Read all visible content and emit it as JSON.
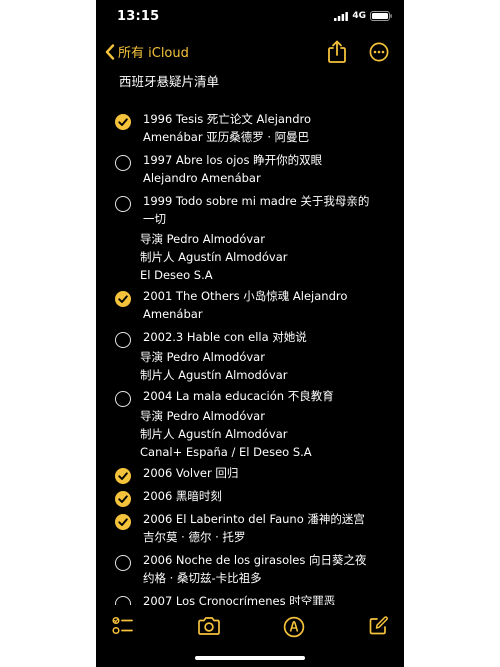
{
  "status_bar": {
    "time": "13:15",
    "network": "4G"
  },
  "nav": {
    "back_label": "所有 iCloud"
  },
  "note": {
    "title": "西班牙悬疑片清单",
    "items": [
      {
        "checked": true,
        "lines": [
          "1996 Tesis 死亡论文 Alejandro",
          "Amenábar 亚历桑德罗 · 阿曼巴"
        ],
        "sub": []
      },
      {
        "checked": false,
        "lines": [
          "1997 Abre los ojos 睁开你的双眼",
          "Alejandro Amenábar"
        ],
        "sub": []
      },
      {
        "checked": false,
        "lines": [
          "1999 Todo sobre mi madre 关于我母亲的",
          "一切"
        ],
        "sub": [
          "导演 Pedro Almodóvar",
          "制片人 Agustín Almodóvar",
          "El Deseo S.A"
        ]
      },
      {
        "checked": true,
        "lines": [
          "2001 The Others 小岛惊魂 Alejandro",
          "Amenábar"
        ],
        "sub": []
      },
      {
        "checked": false,
        "lines": [
          "2002.3 Hable con ella 对她说"
        ],
        "sub": [
          "导演 Pedro Almodóvar",
          "制片人 Agustín Almodóvar"
        ]
      },
      {
        "checked": false,
        "lines": [
          "2004 La mala educación 不良教育"
        ],
        "sub": [
          "导演 Pedro Almodóvar",
          "制片人 Agustín Almodóvar",
          "Canal+ España / El Deseo S.A"
        ]
      },
      {
        "checked": true,
        "lines": [
          "2006 Volver 回归"
        ],
        "sub": []
      },
      {
        "checked": true,
        "lines": [
          "2006 黑暗时刻"
        ],
        "sub": []
      },
      {
        "checked": true,
        "lines": [
          "2006 El Laberinto del Fauno 潘神的迷宫",
          "吉尔莫 · 德尔 · 托罗"
        ],
        "sub": []
      },
      {
        "checked": false,
        "lines": [
          "2006 Noche de los girasoles 向日葵之夜",
          "约格 · 桑切兹-卡比祖多"
        ],
        "sub": []
      },
      {
        "checked": false,
        "lines": [
          "2007 Los Cronocrímenes 时空罪恶"
        ],
        "sub": []
      }
    ]
  },
  "toolbar": {
    "icons": [
      "checklist-icon",
      "camera-icon",
      "markup-pen-icon",
      "compose-icon"
    ]
  },
  "colors": {
    "accent": "#f5c23c",
    "background": "#000000",
    "text": "#ffffff"
  }
}
